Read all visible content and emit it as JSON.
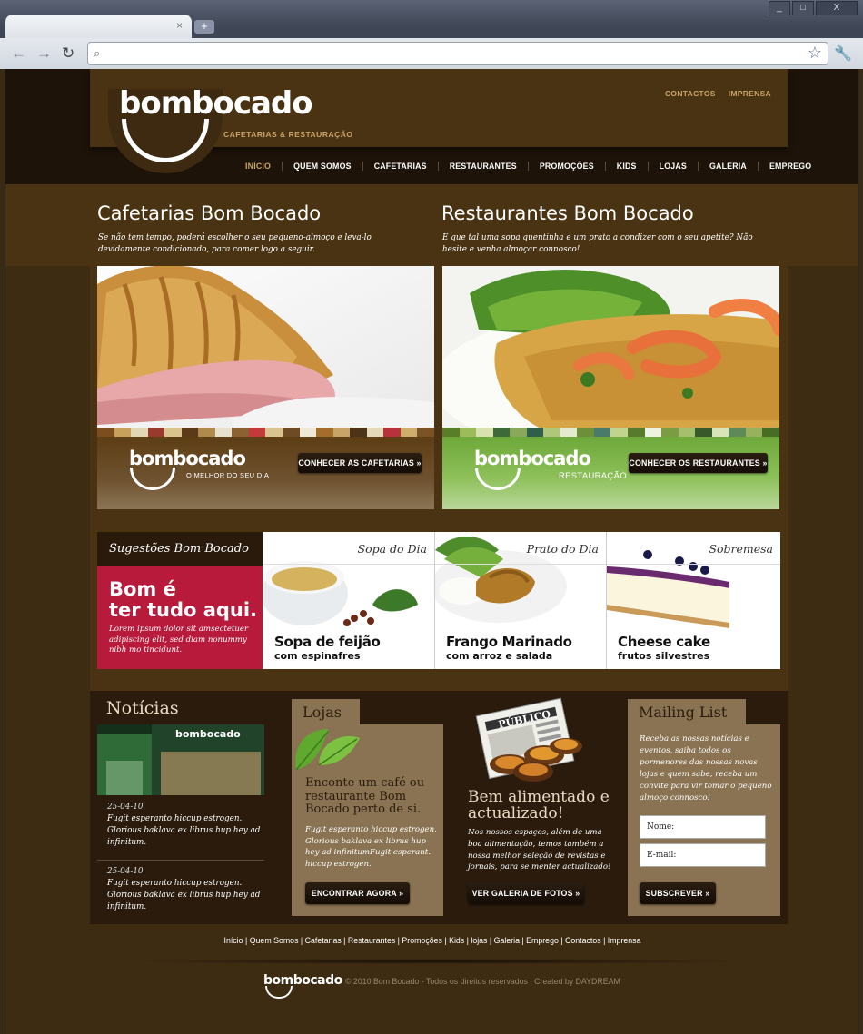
{
  "browser": {
    "tab_close": "×",
    "new_tab": "+",
    "win_min": "_",
    "win_max": "□",
    "win_close": "X",
    "back_icon": "←",
    "forward_icon": "→",
    "reload_icon": "↻",
    "search_icon": "⌕",
    "star_icon": "☆",
    "wrench_icon": "🔧",
    "url": ""
  },
  "header": {
    "logo": "bombocado",
    "tagline": "CAFETARIAS & RESTAURAÇÃO",
    "toplinks": [
      "CONTACTOS",
      "IMPRENSA"
    ],
    "nav": [
      "INÍCIO",
      "QUEM SOMOS",
      "CAFETARIAS",
      "RESTAURANTES",
      "PROMOÇÕES",
      "KIDS",
      "LOJAS",
      "GALERIA",
      "EMPREGO"
    ],
    "active": "INÍCIO"
  },
  "intro": {
    "left_title": "Cafetarias Bom Bocado",
    "left_text": "Se não tem tempo, poderá escolher o seu pequeno-almoço e leva-lo devidamente condicionado, para comer logo a seguir.",
    "right_title": "Restaurantes Bom Bocado",
    "right_text": "E que tal uma sopa quentinha e um prato a condizer com o seu apetite? Não hesite e venha almoçar connosco!"
  },
  "promos": {
    "cafe_logo": "bombocado",
    "cafe_sub": "O MELHOR DO SEU DIA",
    "cafe_button": "CONHECER AS CAFETARIAS »",
    "rest_logo": "bombocado",
    "rest_sub": "RESTAURAÇÃO",
    "rest_button": "CONHECER OS RESTAURANTES »"
  },
  "suggestions": {
    "heading": "Sugestões Bom Bocado",
    "slogan_1": "Bom é",
    "slogan_2": "ter tudo aqui.",
    "lorem": "Lorem ipsum dolor sit amsectetuer adipiscing elit, sed diam nonummy nibh mo tincidunt.",
    "dishes": [
      {
        "category": "Sopa do Dia",
        "name": "Sopa de feijão",
        "sub": "com espinafres"
      },
      {
        "category": "Prato do Dia",
        "name": "Frango Marinado",
        "sub": "com arroz e salada"
      },
      {
        "category": "Sobremesa",
        "name": "Cheese cake",
        "sub": "frutos silvestres"
      }
    ]
  },
  "news": {
    "title": "Notícias",
    "photo_sign": "bombocado",
    "items": [
      {
        "date": "25-04-10",
        "text": "Fugit esperanto hiccup estrogen. Glorious baklava ex librus hup hey ad infinitum."
      },
      {
        "date": "25-04-10",
        "text": "Fugit esperanto hiccup estrogen. Glorious baklava ex librus hup hey ad infinitum."
      }
    ]
  },
  "lojas": {
    "tab": "Lojas",
    "heading": "Enconte um café ou restaurante Bom Bocado perto de si.",
    "text": "Fugit esperanto hiccup estrogen. Glorious baklava ex librus hup hey ad infinitumFugit esperant. hiccup estrogen.",
    "button": "ENCONTRAR AGORA »"
  },
  "magazine": {
    "paper_name": "PÚBLICO",
    "heading": "Bem alimentado e actualizado!",
    "text": "Nos nossos espaços, além de uma boa alimentação, temos também a nossa melhor seleção de revistas e jornais, para se menter actualizado!",
    "button": "VER GALERIA DE FOTOS »"
  },
  "mailing": {
    "tab": "Mailing List",
    "text": "Receba as nossas notícias e eventos, saiba todos os pormenores das nossas novas lojas e quem sabe, receba um convite para vir tomar o pequeno almoço connosco!",
    "name_label": "Nome:",
    "email_label": "E-mail:",
    "button": "SUBSCREVER »"
  },
  "footer": {
    "links": "Início   |   Quem Somos   |   Cafetarias  |  Restaurantes  |  Promoções  |  Kids  |  lojas   |   Galeria   |   Emprego  |  Contactos  |  Imprensa",
    "logo": "bombocado",
    "copyright": "© 2010 Bom Bocado - Todos os direitos reservados   |   Created by DAYDREAM"
  }
}
